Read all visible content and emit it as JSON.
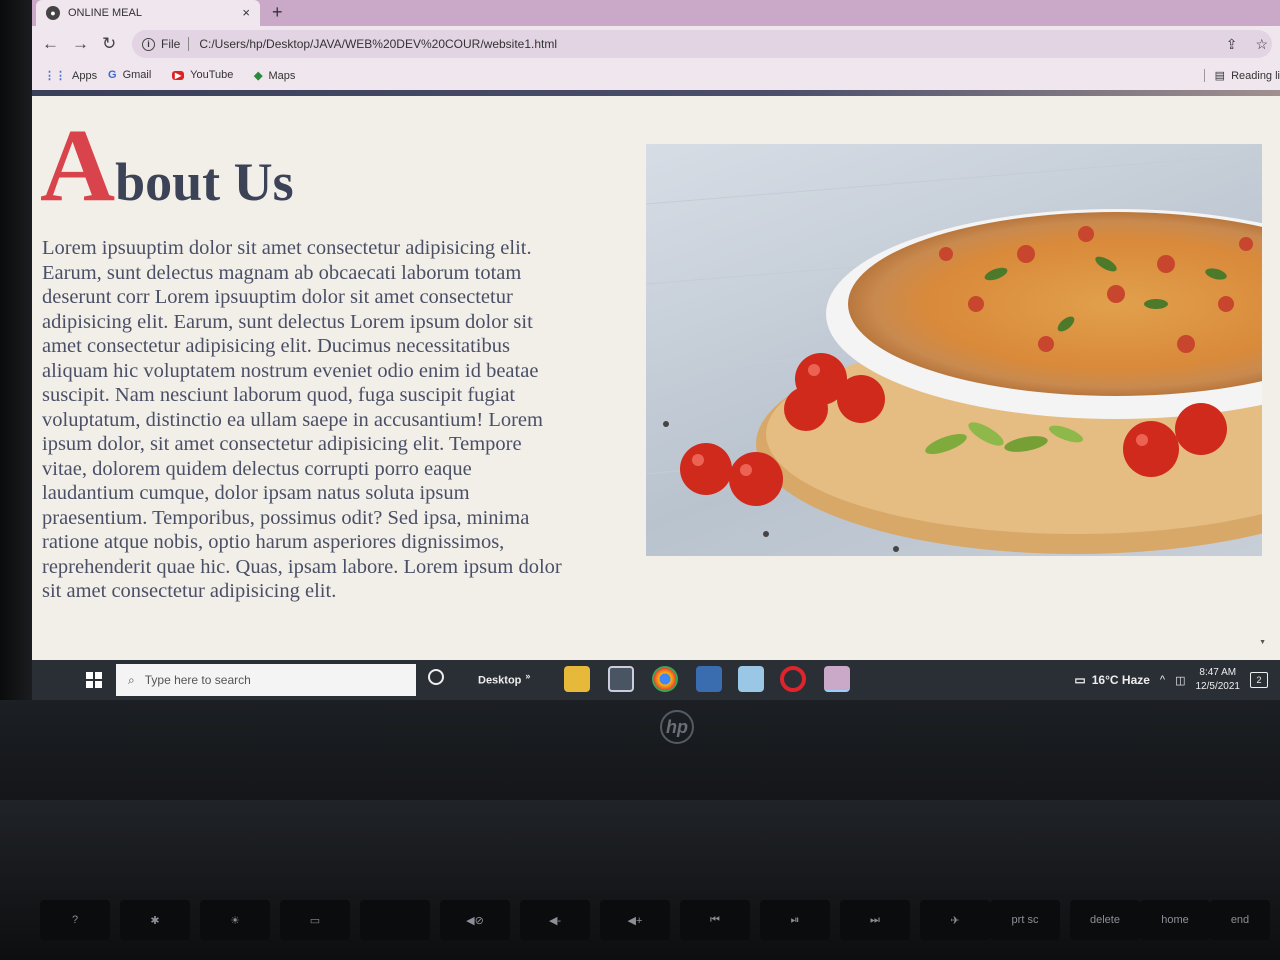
{
  "browser": {
    "tab_title": "ONLINE MEAL",
    "tab_close": "×",
    "new_tab": "+",
    "back": "←",
    "forward": "→",
    "reload": "↻",
    "scheme": "File",
    "url": "C:/Users/hp/Desktop/JAVA/WEB%20DEV%20COUR/website1.html",
    "bookmarks": [
      {
        "label": "Apps",
        "icon": "apps-grid-icon"
      },
      {
        "label": "Gmail",
        "icon": "google-g-icon"
      },
      {
        "label": "YouTube",
        "icon": "youtube-icon"
      },
      {
        "label": "Maps",
        "icon": "maps-icon"
      }
    ],
    "reading_list": "Reading li"
  },
  "page": {
    "heading_initial": "A",
    "heading_rest": "bout Us",
    "body": "Lorem ipsuuptim dolor sit amet consectetur adipisicing elit. Earum, sunt delectus magnam ab obcaecati laborum totam deserunt corr Lorem ipsuuptim dolor sit amet consectetur adipisicing elit. Earum, sunt delectus Lorem ipsum dolor sit amet consectetur adipisicing elit. Ducimus necessitatibus aliquam hic voluptatem nostrum eveniet odio enim id beatae suscipit. Nam nesciunt laborum quod, fuga suscipit fugiat voluptatum, distinctio ea ullam saepe in accusantium! Lorem ipsum dolor, sit amet consectetur adipisicing elit. Tempore vitae, dolorem quidem delectus corrupti porro eaque laudantium cumque, dolor ipsam natus soluta ipsum praesentium. Temporibus, possimus odit? Sed ipsa, minima ratione atque nobis, optio harum asperiores dignissimos, reprehenderit quae hic. Quas, ipsam labore. Lorem ipsum dolor sit amet consectetur adipisicing elit."
  },
  "taskbar": {
    "search_placeholder": "Type here to search",
    "desktop": "Desktop",
    "desktop_chevron": "»",
    "weather": "16°C Haze",
    "time": "8:47 AM",
    "date": "12/5/2021",
    "notifications": "2"
  },
  "keyboard": {
    "keys": [
      "prt sc",
      "delete",
      "home",
      "end"
    ]
  },
  "laptop": {
    "logo": "hp"
  },
  "colors": {
    "accent_red": "#d9434b",
    "heading_navy": "#3c4356"
  }
}
